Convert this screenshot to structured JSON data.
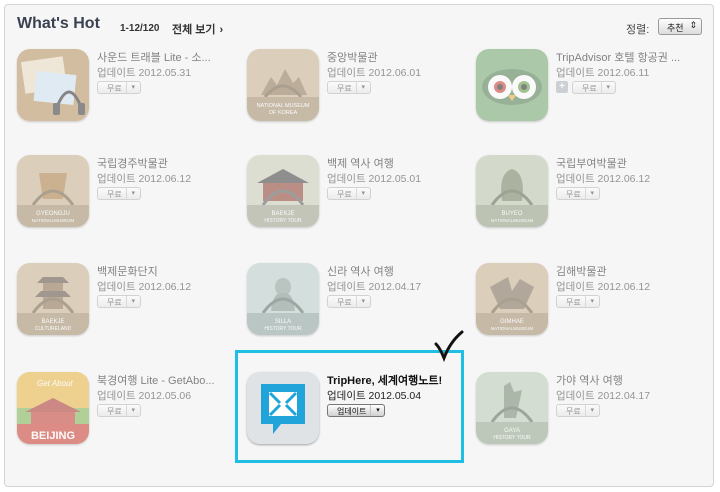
{
  "header": {
    "title": "What's Hot",
    "range": "1-12/120",
    "view_all": "전체 보기",
    "view_all_chevron": "›",
    "sort_label": "정렬:",
    "sort_value": "추천"
  },
  "apps": [
    {
      "name": "사운드 트래블 Lite - 소...",
      "date": "업데이트 2012.05.31",
      "button": "무료",
      "icon": "sound-travel-icon"
    },
    {
      "name": "중앙박물관",
      "date": "업데이트 2012.06.01",
      "button": "무료",
      "icon": "national-museum-icon",
      "icon_text": [
        "NATIONAL MUSEUM",
        "OF KOREA"
      ]
    },
    {
      "name": "TripAdvisor 호텔 항공권 ...",
      "date": "업데이트 2012.06.11",
      "button": "무료",
      "icon": "tripadvisor-owl-icon",
      "extra": "+"
    },
    {
      "name": "국립경주박물관",
      "date": "업데이트 2012.06.12",
      "button": "무료",
      "icon": "gyeongju-museum-icon",
      "icon_text": [
        "GYEONGJU",
        "NATIONALMUSEUM"
      ]
    },
    {
      "name": "백제 역사 여행",
      "date": "업데이트 2012.05.01",
      "button": "무료",
      "icon": "baekje-tour-icon",
      "icon_text": [
        "BAEKJE",
        "HISTORY TOUR"
      ]
    },
    {
      "name": "국립부여박물관",
      "date": "업데이트 2012.06.12",
      "button": "무료",
      "icon": "buyeo-museum-icon",
      "icon_text": [
        "BUYEO",
        "NATIONALMUSEUM"
      ]
    },
    {
      "name": "백제문화단지",
      "date": "업데이트 2012.06.12",
      "button": "무료",
      "icon": "baekje-culture-icon",
      "icon_text": [
        "BAEKJE",
        "CULTURELAND"
      ]
    },
    {
      "name": "신라 역사 여행",
      "date": "업데이트 2012.04.17",
      "button": "무료",
      "icon": "silla-tour-icon",
      "icon_text": [
        "SILLA",
        "HISTORY TOUR"
      ]
    },
    {
      "name": "김해박물관",
      "date": "업데이트 2012.06.12",
      "button": "무료",
      "icon": "gimhae-museum-icon",
      "icon_text": [
        "GIMHAE",
        "NATIONALMUSEUM"
      ]
    },
    {
      "name": "북경여행 Lite - GetAbo...",
      "date": "업데이트 2012.05.06",
      "button": "무료",
      "icon": "beijing-getabout-icon",
      "icon_text": [
        "Get About",
        "BEIJING"
      ]
    },
    {
      "name": "TripHere, 세계여행노트!",
      "date": "업데이트 2012.05.04",
      "button": "업데이트",
      "icon": "triphere-icon"
    },
    {
      "name": "가야 역사 여행",
      "date": "업데이트 2012.04.17",
      "button": "무료",
      "icon": "gaya-tour-icon",
      "icon_text": [
        "GAYA",
        "HISTORY TOUR"
      ]
    }
  ],
  "colors": {
    "highlight": "#1fbfe4",
    "museum_bg": "#c6ae8c",
    "tour_bg": "#c9ccb5",
    "tripadvisor_green": "#6fa36a",
    "beijing_red": "#c8352a",
    "triphere_blue": "#21a4d9"
  }
}
